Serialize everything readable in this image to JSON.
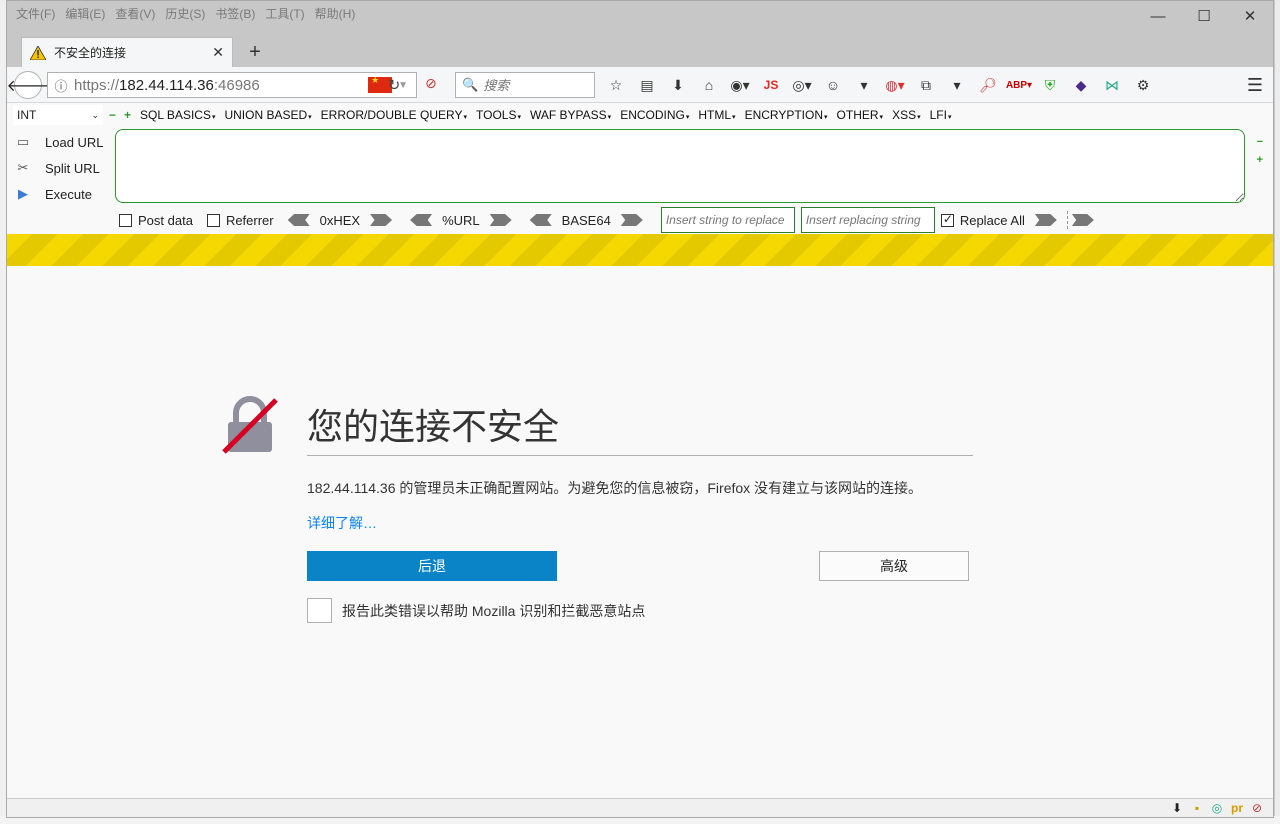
{
  "menubar": [
    "文件(F)",
    "编辑(E)",
    "查看(V)",
    "历史(S)",
    "书签(B)",
    "工具(T)",
    "帮助(H)"
  ],
  "tab": {
    "title": "不安全的连接"
  },
  "url": {
    "protocol": "https://",
    "host": "182.44.114.36",
    "port": ":46986"
  },
  "search": {
    "placeholder": "搜索"
  },
  "nav_icons": [
    "star-icon",
    "reader-icon",
    "download-icon",
    "home-icon",
    "addon-icon",
    "js-icon",
    "chrome-icon",
    "palette-icon",
    "overflow-icon",
    "firebug-icon",
    "sync-icon",
    "zoom-icon",
    "adblock-icon",
    "shield-icon",
    "diamond-icon",
    "wappalyzer-icon",
    "settings-icon"
  ],
  "hackbar": {
    "select_value": "INT",
    "menu": [
      "SQL BASICS",
      "UNION BASED",
      "ERROR/DOUBLE QUERY",
      "TOOLS",
      "WAF BYPASS",
      "ENCODING",
      "HTML",
      "ENCRYPTION",
      "OTHER",
      "XSS",
      "LFI"
    ],
    "load_url": "Load URL",
    "split_url": "Split URL",
    "execute": "Execute",
    "post_data": "Post data",
    "referrer": "Referrer",
    "hex": "0xHEX",
    "url_enc": "%URL",
    "base64": "BASE64",
    "replace_placeholder": "Insert string to replace",
    "replacing_placeholder": "Insert replacing string",
    "replace_all": "Replace All"
  },
  "error": {
    "title": "您的连接不安全",
    "description": "182.44.114.36 的管理员未正确配置网站。为避免您的信息被窃，Firefox 没有建立与该网站的连接。",
    "learn_more": "详细了解…",
    "back_button": "后退",
    "advanced_button": "高级",
    "report_label": "报告此类错误以帮助 Mozilla 识别和拦截恶意站点"
  },
  "colors": {
    "primary_button": "#0a84c6",
    "link": "#0a84ff",
    "stripe": "#f5d800",
    "hackbar_border": "#2b9a2b"
  }
}
